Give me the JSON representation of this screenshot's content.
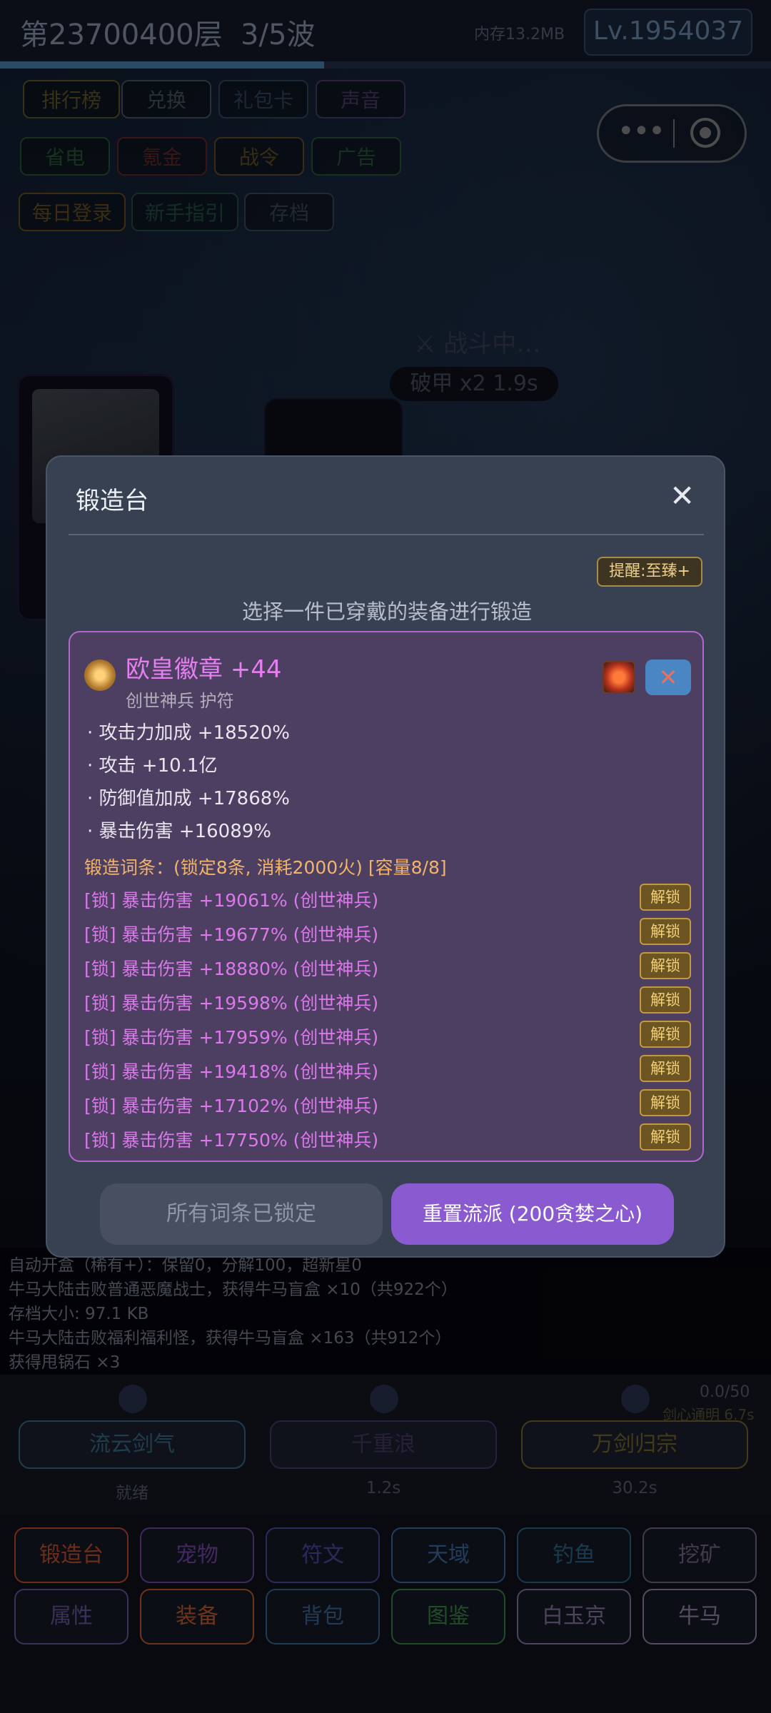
{
  "status_bar": {
    "floor": "第23700400层",
    "wave": "3/5波",
    "memory": "内存13.2MB",
    "level": "Lv.1954037",
    "wave_progress": 0.42
  },
  "top_buttons": [
    {
      "label": "排行榜",
      "color": "#b8a24a"
    },
    {
      "label": "兑换",
      "color": "#8aa0b5"
    },
    {
      "label": "礼包卡",
      "color": "#5f86b3"
    },
    {
      "label": "声音",
      "color": "#9a6fc6"
    },
    {
      "label": "省电",
      "color": "#4ea36a"
    },
    {
      "label": "氪金",
      "color": "#c04a4a"
    },
    {
      "label": "战令",
      "color": "#b89646"
    },
    {
      "label": "广告",
      "color": "#4ea36a"
    },
    {
      "label": "每日登录",
      "color": "#c2963f"
    },
    {
      "label": "新手指引",
      "color": "#3f9a7a"
    },
    {
      "label": "存档",
      "color": "#6f8aa6"
    }
  ],
  "scene": {
    "fight_status": "⚔ 战斗中…",
    "buff": "破甲 x2 1.9s"
  },
  "modal": {
    "title": "锻造台",
    "close_icon": "close-icon",
    "hint": "提醒:至臻+",
    "instruction": "选择一件已穿戴的装备进行锻造",
    "item": {
      "name": "欧皇徽章 +44",
      "subtitle": "创世神兵 护符",
      "remove_label": "✕",
      "stats": [
        "· 攻击力加成 +18520%",
        "· 攻击 +10.1亿",
        "· 防御值加成 +17868%",
        "· 暴击伤害 +16089%"
      ],
      "forge_header": "锻造词条：(锁定8条, 消耗2000火) [容量8/8]",
      "affixes": [
        "[锁] 暴击伤害 +19061% (创世神兵)",
        "[锁] 暴击伤害 +19677% (创世神兵)",
        "[锁] 暴击伤害 +18880% (创世神兵)",
        "[锁] 暴击伤害 +19598% (创世神兵)",
        "[锁] 暴击伤害 +17959% (创世神兵)",
        "[锁] 暴击伤害 +19418% (创世神兵)",
        "[锁] 暴击伤害 +17102% (创世神兵)",
        "[锁] 暴击伤害 +17750% (创世神兵)"
      ],
      "unlock_label": "解锁"
    },
    "locked_all_label": "所有词条已锁定",
    "reset_label": "重置流派 (200贪婪之心)"
  },
  "log": [
    "自动开盒（稀有+）：保留0，分解100，超新星0",
    "牛马大陆击败普通恶魔战士，获得牛马盲盒 ×10（共922个）",
    "存档大小: 97.1 KB",
    "牛马大陆击败福利福利怪，获得牛马盲盒 ×163（共912个）",
    "获得甩锅石 ×3"
  ],
  "skills": [
    {
      "name": "流云剑气",
      "status": "就绪",
      "color": "#3b6f8a"
    },
    {
      "name": "千重浪",
      "status": "1.2s",
      "color": "#4a3b6a"
    },
    {
      "name": "万剑归宗",
      "status": "30.2s",
      "color": "#7a6a2a"
    }
  ],
  "skill_counter": "0.0/50",
  "skill_counter_sub": "剑心通明 6.7s",
  "nav_row1": [
    {
      "label": "锻造台",
      "color": "#c8522f"
    },
    {
      "label": "宠物",
      "color": "#7a4ab0"
    },
    {
      "label": "符文",
      "color": "#4a4fa8"
    },
    {
      "label": "天域",
      "color": "#3c6ea8"
    },
    {
      "label": "钓鱼",
      "color": "#2f6a8a"
    },
    {
      "label": "挖矿",
      "color": "#7b6a8e"
    }
  ],
  "nav_row2": [
    {
      "label": "属性",
      "color": "#6a5aa0"
    },
    {
      "label": "装备",
      "color": "#c8602f"
    },
    {
      "label": "背包",
      "color": "#3f6a9a"
    },
    {
      "label": "图鉴",
      "color": "#3c8a4a"
    },
    {
      "label": "白玉京",
      "color": "#8a7aa8"
    },
    {
      "label": "牛马",
      "color": "#9a8ab0"
    }
  ]
}
